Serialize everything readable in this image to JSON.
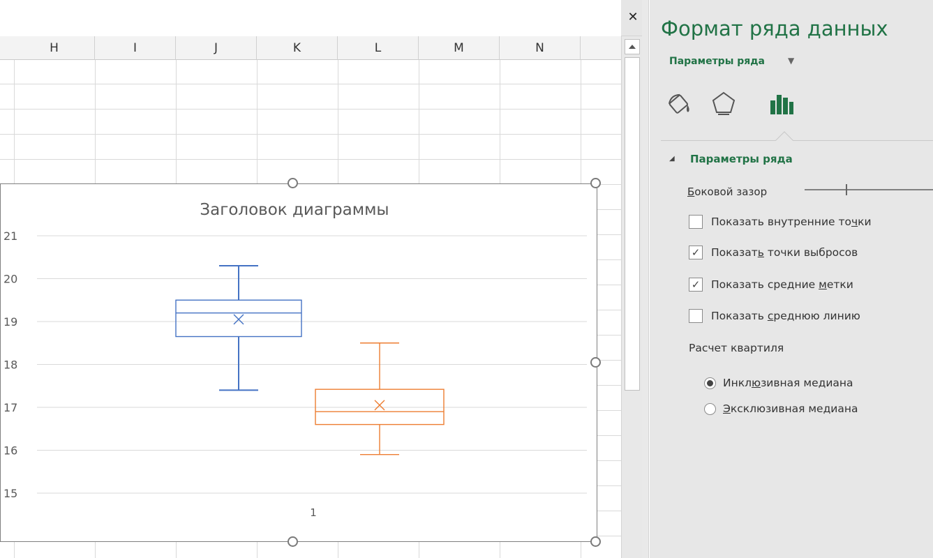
{
  "spreadsheet": {
    "columns": [
      "H",
      "I",
      "J",
      "K",
      "L",
      "M",
      "N"
    ]
  },
  "chart": {
    "title": "Заголовок диаграммы",
    "x_tick_label": "1"
  },
  "chart_data": {
    "type": "box",
    "title": "Заголовок диаграммы",
    "categories": [
      "1"
    ],
    "ylim": [
      15,
      21
    ],
    "y_ticks": [
      15,
      16,
      17,
      18,
      19,
      20,
      21
    ],
    "grid": true,
    "series": [
      {
        "color": "#4472c4",
        "min": 17.4,
        "q1": 18.65,
        "median": 19.2,
        "q3": 19.5,
        "max": 20.3,
        "mean": 19.05
      },
      {
        "color": "#ed7d31",
        "min": 15.9,
        "q1": 16.6,
        "median": 16.9,
        "q3": 17.42,
        "max": 18.5,
        "mean": 17.05
      }
    ]
  },
  "pane": {
    "title": "Формат ряда данных",
    "subtitle": "Параметры ряда",
    "section_title": "Параметры ряда",
    "gap": {
      "label_first": "Б",
      "label_rest": "оковой зазор",
      "value": 0.32
    },
    "checkboxes": [
      {
        "pre": "Показать внутренние то",
        "ul": "ч",
        "post": "ки",
        "checked": false
      },
      {
        "pre": "Показат",
        "ul": "ь",
        "post": " точки выбросов",
        "checked": true
      },
      {
        "pre": "Показать средние ",
        "ul": "м",
        "post": "етки",
        "checked": true
      },
      {
        "pre": "Показать ",
        "ul": "с",
        "post": "реднюю линию",
        "checked": false
      }
    ],
    "quartile_label": "Расчет квартиля",
    "radios": [
      {
        "pre": "Инкл",
        "ul": "ю",
        "post": "зивная медиана",
        "selected": true
      },
      {
        "pre": "",
        "ul": "Э",
        "post": "ксклюзивная медиана",
        "selected": false
      }
    ],
    "accent_color": "#217346"
  }
}
